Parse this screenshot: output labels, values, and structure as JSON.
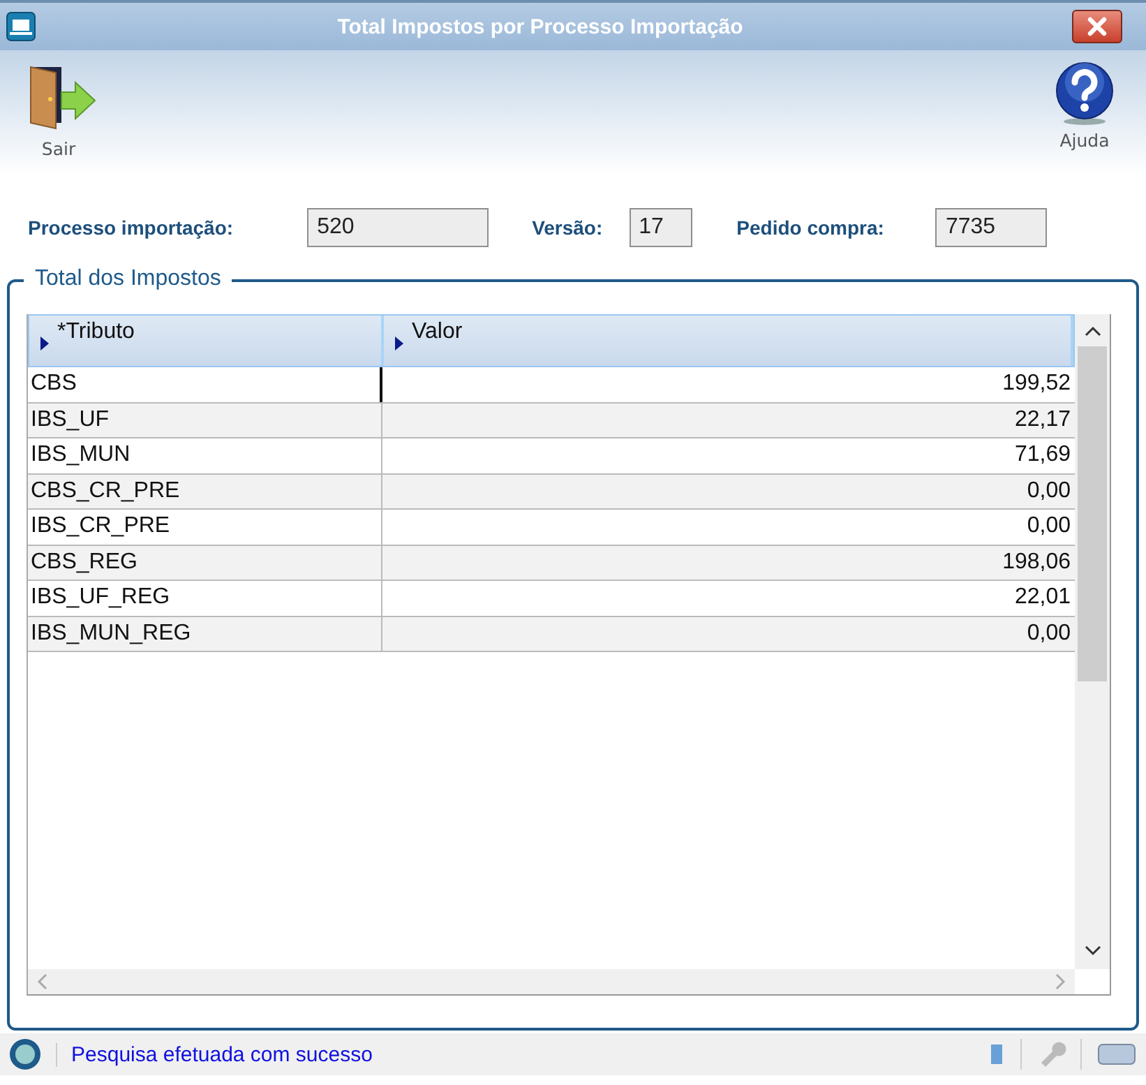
{
  "window": {
    "title": "Total Impostos por Processo Importação"
  },
  "toolbar": [
    {
      "kind": "exit",
      "label": "Sair"
    },
    {
      "kind": "help",
      "label": "Ajuda"
    }
  ],
  "fields": [
    {
      "label": "Processo importação:",
      "value": "520"
    },
    {
      "label": "Versão:",
      "value": "17"
    },
    {
      "label": "Pedido compra:",
      "value": "7735"
    }
  ],
  "group": {
    "title": "Total dos Impostos",
    "table": {
      "columns": [
        "*Tributo",
        "Valor"
      ],
      "rows": [
        {
          "cells": [
            "CBS",
            "199,52"
          ],
          "focused": true
        },
        {
          "cells": [
            "IBS_UF",
            "22,17"
          ],
          "focused": false
        },
        {
          "cells": [
            "IBS_MUN",
            "71,69"
          ],
          "focused": false
        },
        {
          "cells": [
            "CBS_CR_PRE",
            "0,00"
          ],
          "focused": false
        },
        {
          "cells": [
            "IBS_CR_PRE",
            "0,00"
          ],
          "focused": false
        },
        {
          "cells": [
            "CBS_REG",
            "198,06"
          ],
          "focused": false
        },
        {
          "cells": [
            "IBS_UF_REG",
            "22,01"
          ],
          "focused": false
        },
        {
          "cells": [
            "IBS_MUN_REG",
            "0,00"
          ],
          "focused": false
        }
      ]
    }
  },
  "status_bar": {
    "message": "Pesquisa efetuada com sucesso"
  }
}
